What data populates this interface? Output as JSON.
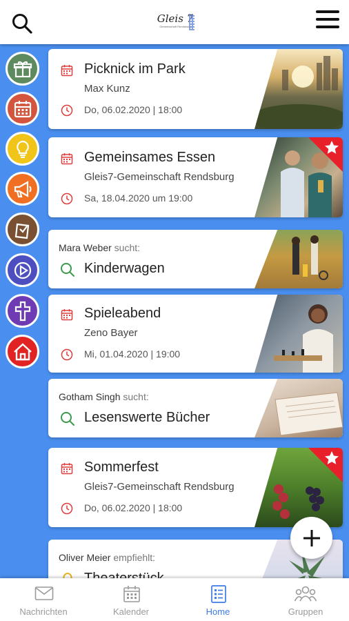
{
  "header": {
    "logo_text": "Gleis 7",
    "logo_sub": "Gemeinschaft Rendsburg"
  },
  "sidebar": [
    {
      "name": "gift-icon",
      "color": "#5d8a5e"
    },
    {
      "name": "calendar-icon",
      "color": "#d3553d"
    },
    {
      "name": "lightbulb-icon",
      "color": "#f0c419"
    },
    {
      "name": "megaphone-icon",
      "color": "#f06f23"
    },
    {
      "name": "note-icon",
      "color": "#7a5033"
    },
    {
      "name": "play-icon",
      "color": "#4d4fc0"
    },
    {
      "name": "cross-icon",
      "color": "#6e3bb3"
    },
    {
      "name": "home-icon",
      "color": "#e12323"
    }
  ],
  "feed": {
    "card1": {
      "title": "Picknick im Park",
      "subtitle": "Max Kunz",
      "date": "Do, 06.02.2020 | 18:00"
    },
    "card2": {
      "title": "Gemeinsames Essen",
      "subtitle": "Gleis7-Gemeinschaft Rendsburg",
      "date": "Sa, 18.04.2020 um 19:00",
      "featured": true
    },
    "seek1": {
      "who": "Mara Weber",
      "verb": "sucht:",
      "what": "Kinderwagen"
    },
    "card3": {
      "title": "Spieleabend",
      "subtitle": "Zeno Bayer",
      "date": "Mi, 01.04.2020 | 19:00"
    },
    "seek2": {
      "who": "Gotham Singh",
      "verb": "sucht:",
      "what": "Lesenswerte Bücher"
    },
    "card4": {
      "title": "Sommerfest",
      "subtitle": "Gleis7-Gemeinschaft Rendsburg",
      "date": "Do, 06.02.2020 | 18:00",
      "featured": true
    },
    "rec1": {
      "who": "Oliver Meier",
      "verb": "empfiehlt:",
      "what": "Theaterstück"
    }
  },
  "nav": {
    "messages": "Nachrichten",
    "calendar": "Kalender",
    "home": "Home",
    "groups": "Gruppen",
    "active": "Home"
  },
  "colors": {
    "accent": "#3c7be8",
    "background": "#4a8ff0",
    "event_red": "#e03a3a",
    "search_green": "#3a9a4a"
  }
}
